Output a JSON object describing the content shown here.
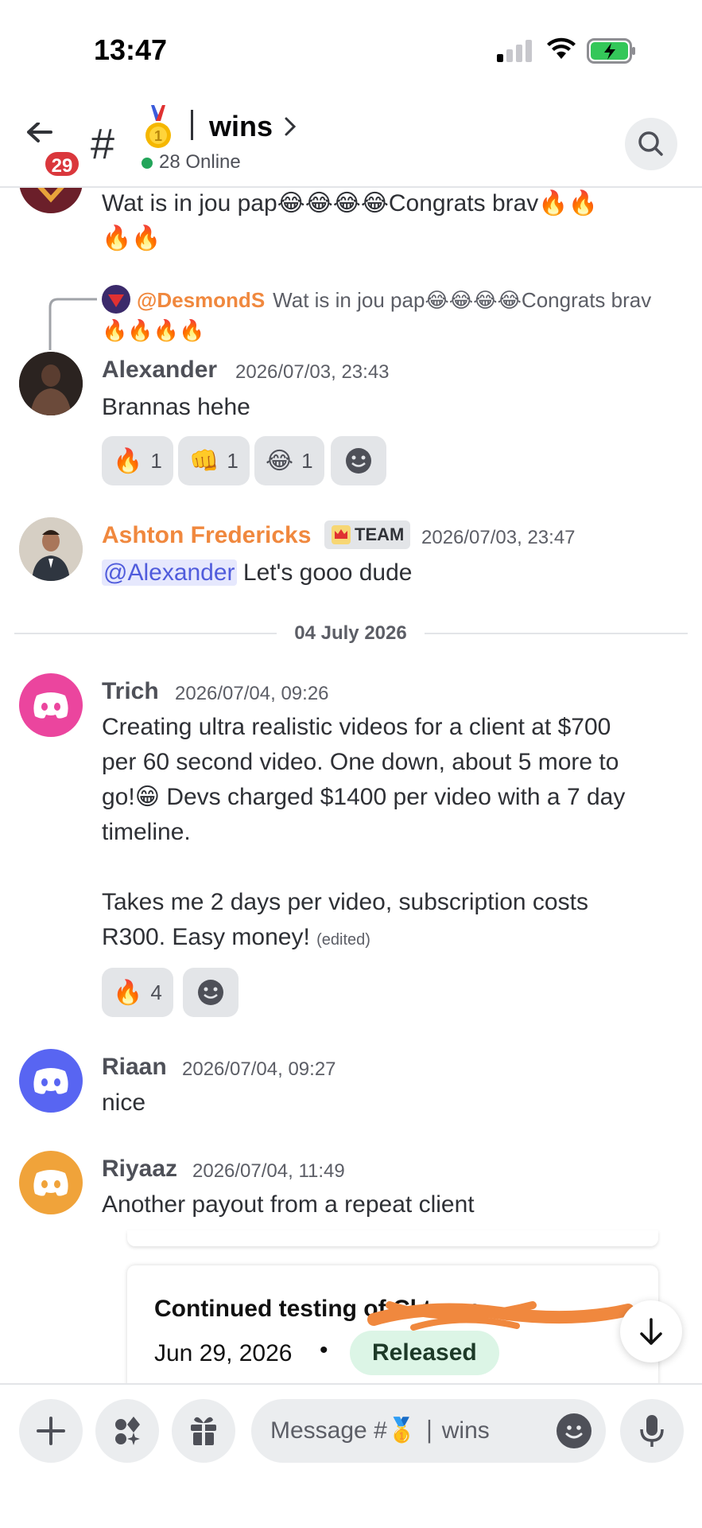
{
  "status_bar": {
    "time": "13:47"
  },
  "header": {
    "unread_count": "29",
    "channel_name": "wins",
    "online": "28 Online"
  },
  "messages": {
    "desmond_cont": {
      "line1": "Wat is in jou pap😂😂😂😂Congrats brav🔥🔥",
      "line2": "🔥🔥"
    },
    "reply": {
      "mention": "@DesmondS",
      "preview": "Wat is in jou pap😂😂😂😂Congrats brav",
      "line2": "🔥🔥🔥🔥"
    },
    "alexander": {
      "author": "Alexander",
      "time": "2026/07/03, 23:43",
      "text": "Brannas hehe",
      "reactions": [
        {
          "emoji": "🔥",
          "count": "1"
        },
        {
          "emoji": "👊",
          "count": "1"
        },
        {
          "emoji": "😂",
          "count": "1"
        }
      ]
    },
    "ashton": {
      "author": "Ashton Fredericks",
      "tag": "TEAM",
      "time": "2026/07/03, 23:47",
      "mention": "@Alexander",
      "text": " Let's gooo dude"
    },
    "date_divider": "04 July 2026",
    "trich": {
      "author": "Trich",
      "time": "2026/07/04, 09:26",
      "lines": [
        "Creating ultra realistic videos for a client at $700",
        "per 60 second video. One down, about 5 more to",
        "go!😁  Devs charged $1400 per video with a 7 day",
        "timeline.",
        "Takes me 2 days per video, subscription costs",
        "R300. Easy money!"
      ],
      "edited": "(edited)",
      "reactions": [
        {
          "emoji": "🔥",
          "count": "4"
        }
      ]
    },
    "riaan": {
      "author": "Riaan",
      "time": "2026/07/04, 09:27",
      "text": "nice"
    },
    "riyaaz": {
      "author": "Riyaaz",
      "time": "2026/07/04, 11:49",
      "text": "Another payout from a repeat client"
    },
    "embed": {
      "title": "Continued testing of Cl          t app.",
      "date": "Jun 29, 2026",
      "dot": "•",
      "status": "Released"
    }
  },
  "composer": {
    "placeholder": "Message #🥇 ∣ wins"
  },
  "colors": {
    "accent": "#5865f2",
    "mention_orange": "#f0883e",
    "online": "#23a55a",
    "badge": "#da373c"
  }
}
